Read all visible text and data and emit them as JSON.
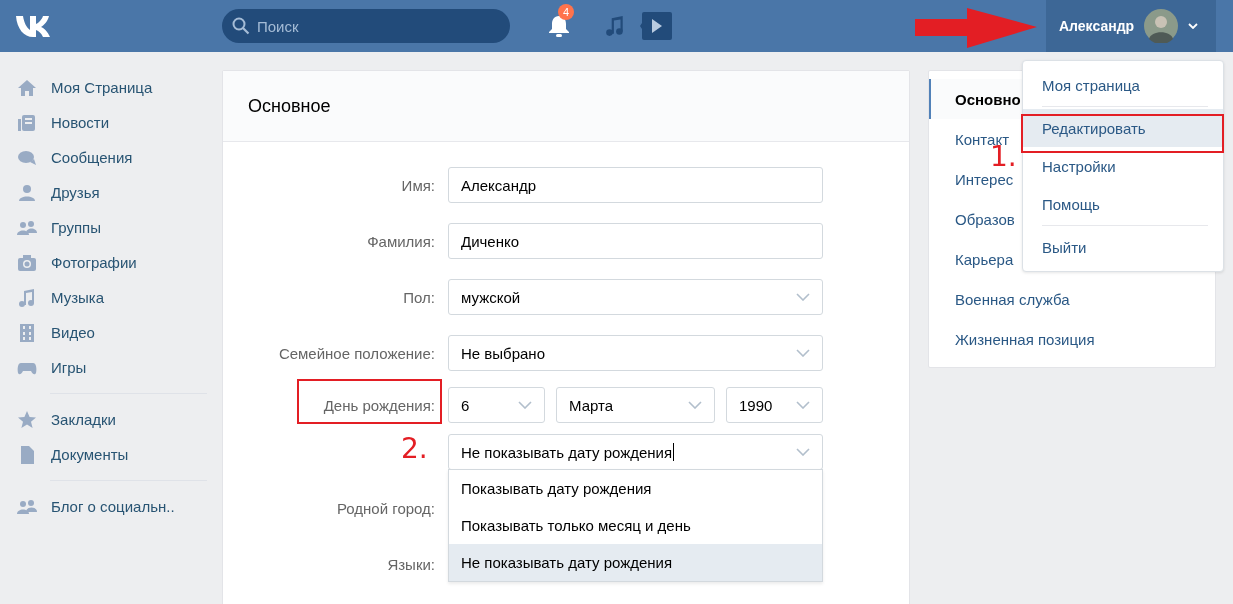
{
  "header": {
    "search": {
      "placeholder": "Поиск"
    },
    "notifications": {
      "badge": "4"
    },
    "user": {
      "name": "Александр"
    }
  },
  "sidebar": {
    "groups": [
      [
        {
          "kind": "home",
          "label": "Моя Страница"
        },
        {
          "kind": "news",
          "label": "Новости"
        },
        {
          "kind": "chat",
          "label": "Сообщения"
        },
        {
          "kind": "person",
          "label": "Друзья"
        },
        {
          "kind": "people",
          "label": "Группы"
        },
        {
          "kind": "camera",
          "label": "Фотографии"
        },
        {
          "kind": "note",
          "label": "Музыка"
        },
        {
          "kind": "film",
          "label": "Видео"
        },
        {
          "kind": "gamepad",
          "label": "Игры"
        }
      ],
      [
        {
          "kind": "star",
          "label": "Закладки"
        },
        {
          "kind": "doc",
          "label": "Документы"
        }
      ],
      [
        {
          "kind": "people",
          "label": "Блог о социальн.."
        }
      ]
    ]
  },
  "card": {
    "title": "Основное",
    "fields": [
      {
        "kind": "input",
        "label": "Имя:",
        "value": "Александр"
      },
      {
        "kind": "input",
        "label": "Фамилия:",
        "value": "Диченко"
      },
      {
        "kind": "select",
        "label": "Пол:",
        "value": "мужской"
      },
      {
        "kind": "select",
        "label": "Семейное положение:",
        "value": "Не выбрано"
      },
      {
        "kind": "birthday",
        "label": "День рождения:",
        "day": "6",
        "month": "Марта",
        "year": "1990",
        "visibility": {
          "value": "Не показывать дату рождения",
          "options": [
            {
              "label": "Показывать дату рождения",
              "selected": false
            },
            {
              "label": "Показывать только месяц и день",
              "selected": false
            },
            {
              "label": "Не показывать дату рождения",
              "selected": true
            }
          ]
        }
      },
      {
        "kind": "hidden",
        "label": "Родной город:"
      },
      {
        "kind": "hidden",
        "label": "Языки:"
      }
    ]
  },
  "right_menu": [
    {
      "label": "Основно",
      "selected": true
    },
    {
      "label": "Контакт",
      "selected": false
    },
    {
      "label": "Интерес",
      "selected": false
    },
    {
      "label": "Образов",
      "selected": false
    },
    {
      "label": "Карьера",
      "selected": false
    },
    {
      "label": "Военная служба",
      "selected": false
    },
    {
      "label": "Жизненная позиция",
      "selected": false
    }
  ],
  "user_menu": {
    "groups": [
      [
        {
          "label": "Моя страница",
          "selected": false
        }
      ],
      [
        {
          "label": "Редактировать",
          "selected": true
        },
        {
          "label": "Настройки",
          "selected": false
        },
        {
          "label": "Помощь",
          "selected": false
        }
      ],
      [
        {
          "label": "Выйти",
          "selected": false
        }
      ]
    ]
  },
  "annotations": [
    {
      "kind": "arrow"
    },
    {
      "kind": "frame"
    },
    {
      "kind": "frame"
    },
    {
      "kind": "number",
      "text": "1."
    },
    {
      "kind": "number",
      "text": "2."
    }
  ]
}
